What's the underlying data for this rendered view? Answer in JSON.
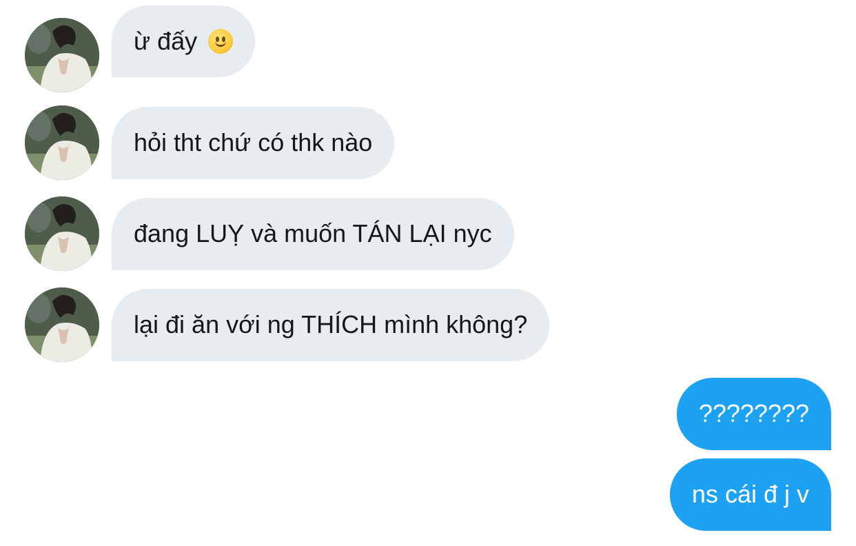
{
  "messages": [
    {
      "from": "them",
      "text": "ừ đấy",
      "emoji": "slightly-smiling-face"
    },
    {
      "from": "them",
      "text": "hỏi tht chứ có thk nào"
    },
    {
      "from": "them",
      "text": "đang LUỴ và muốn TÁN LẠI nyc"
    },
    {
      "from": "them",
      "text": "lại đi ăn với ng THÍCH mình không?"
    },
    {
      "from": "me",
      "text": "????????"
    },
    {
      "from": "me",
      "text": "ns cái đ j v"
    }
  ],
  "colors": {
    "incoming_bubble": "#e6ecf0",
    "incoming_text": "#14171a",
    "outgoing_bubble": "#1da1f2",
    "outgoing_text": "#ffffff",
    "background": "#ffffff"
  },
  "icons": {
    "avatar": "contact-avatar-photo",
    "emoji": "slightly-smiling-face-emoji"
  }
}
